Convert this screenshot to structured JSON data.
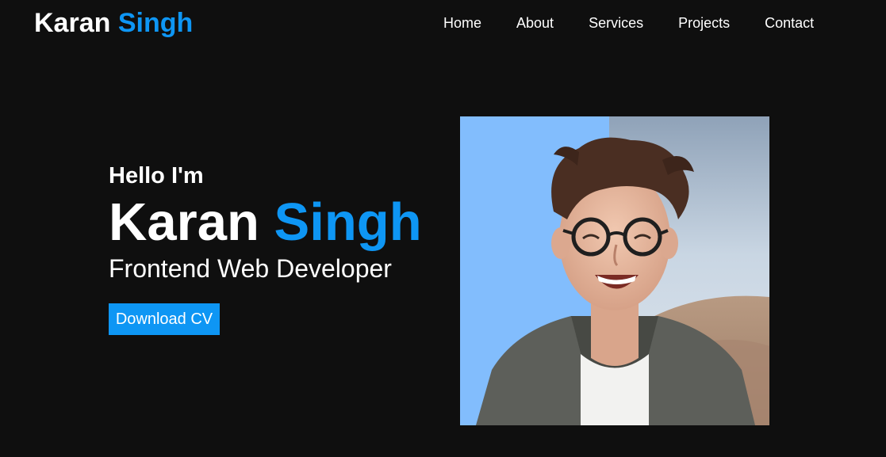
{
  "header": {
    "logo_first": "Karan",
    "logo_last": "Singh"
  },
  "nav": {
    "items": [
      {
        "label": "Home"
      },
      {
        "label": "About"
      },
      {
        "label": "Services"
      },
      {
        "label": "Projects"
      },
      {
        "label": "Contact"
      }
    ]
  },
  "hero": {
    "greeting": "Hello I'm",
    "name_first": "Karan",
    "name_last": "Singh",
    "role": "Frontend Web Developer",
    "cta_label": "Download CV"
  },
  "colors": {
    "background": "#0f0f0f",
    "accent": "#0e96f4",
    "text": "#ffffff"
  }
}
